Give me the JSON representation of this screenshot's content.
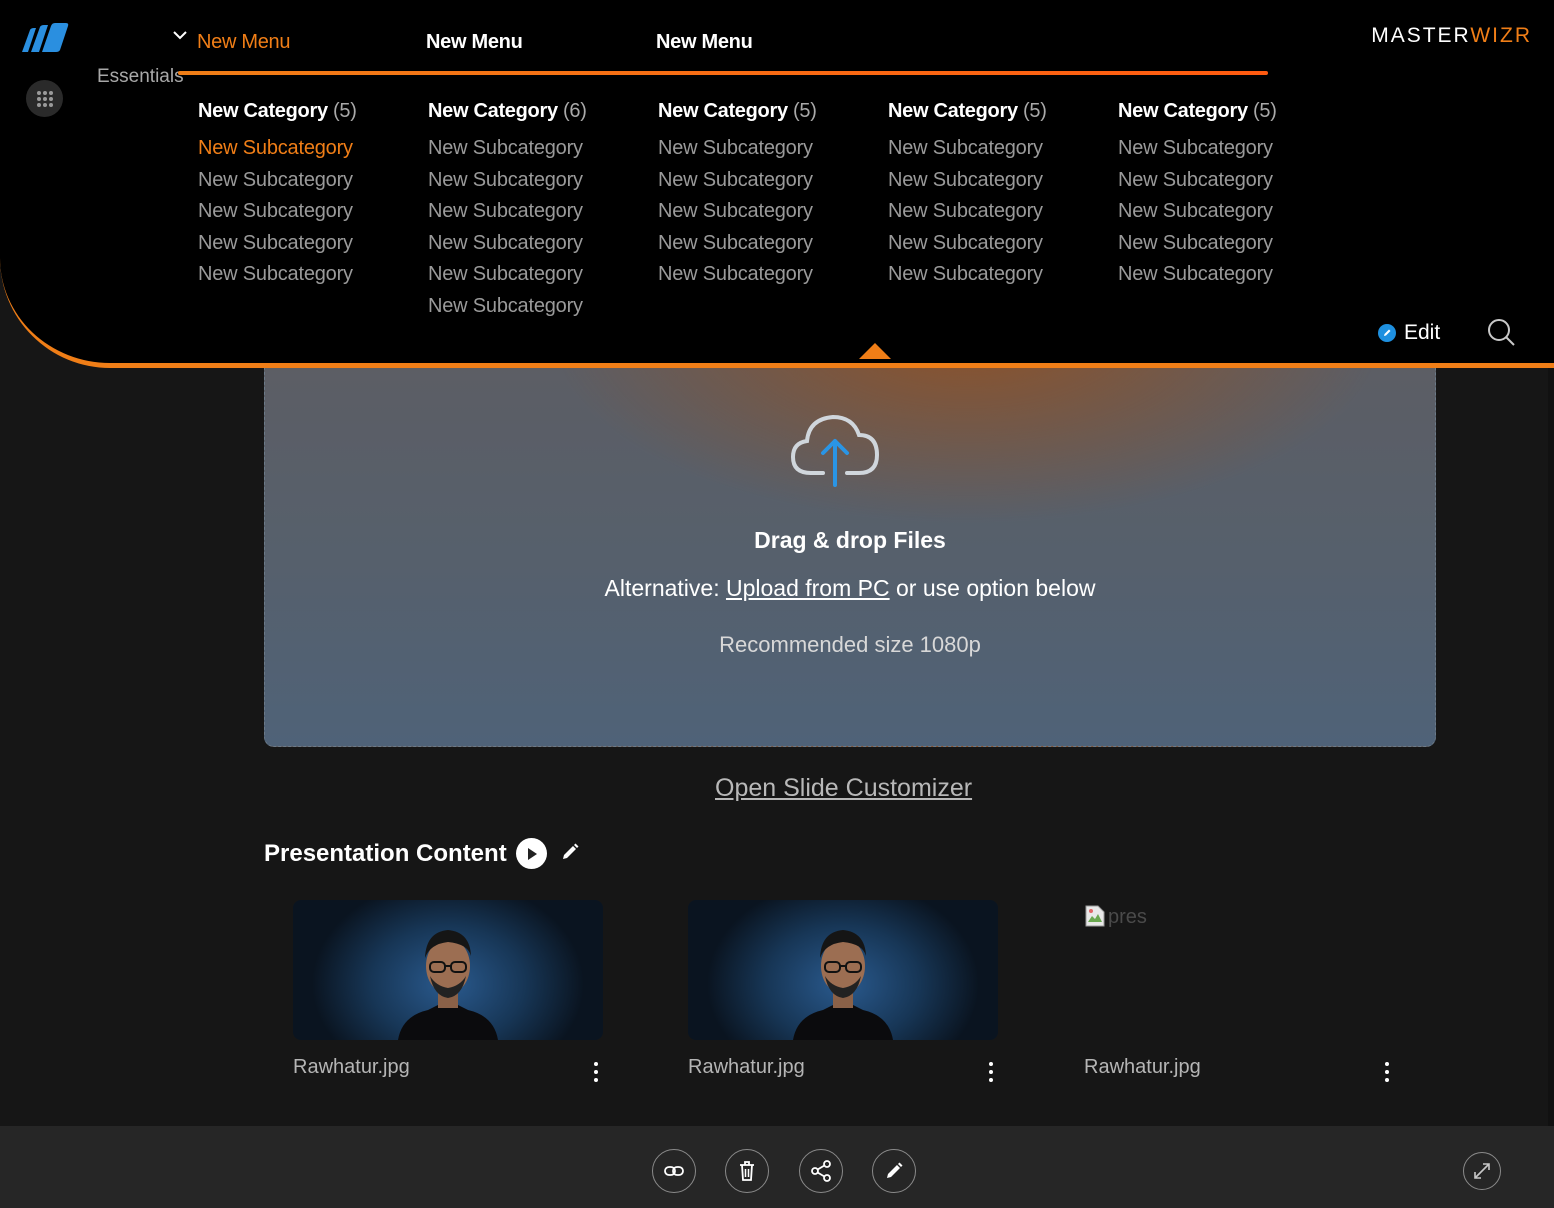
{
  "brand": {
    "master": "MASTER",
    "wizr": "WIZR"
  },
  "sidebar": {
    "essentials_label": "Essentials"
  },
  "menus": [
    {
      "label": "New Menu",
      "active": true
    },
    {
      "label": "New Menu",
      "active": false
    },
    {
      "label": "New Menu",
      "active": false
    }
  ],
  "categories": [
    {
      "title": "New Category",
      "count": "(5)",
      "subs": [
        "New Subcategory",
        "New Subcategory",
        "New Subcategory",
        "New Subcategory",
        "New Subcategory"
      ]
    },
    {
      "title": "New Category",
      "count": "(6)",
      "subs": [
        "New Subcategory",
        "New Subcategory",
        "New Subcategory",
        "New Subcategory",
        "New Subcategory",
        "New Subcategory"
      ]
    },
    {
      "title": "New Category",
      "count": "(5)",
      "subs": [
        "New Subcategory",
        "New Subcategory",
        "New Subcategory",
        "New Subcategory",
        "New Subcategory"
      ]
    },
    {
      "title": "New Category",
      "count": "(5)",
      "subs": [
        "New Subcategory",
        "New Subcategory",
        "New Subcategory",
        "New Subcategory",
        "New Subcategory"
      ]
    },
    {
      "title": "New Category",
      "count": "(5)",
      "subs": [
        "New Subcategory",
        "New Subcategory",
        "New Subcategory",
        "New Subcategory",
        "New Subcategory"
      ]
    }
  ],
  "edit_label": "Edit",
  "upload": {
    "title": "Drag & drop Files",
    "alt_prefix": "Alternative: ",
    "alt_link": "Upload from PC",
    "alt_suffix": " or use option below",
    "recommended": "Recommended size 1080p"
  },
  "customizer_link": "Open Slide Customizer",
  "presentation": {
    "title": "Presentation Content",
    "items": [
      {
        "filename": "Rawhatur.jpg",
        "broken": false
      },
      {
        "filename": "Rawhatur.jpg",
        "broken": false
      },
      {
        "filename": "Rawhatur.jpg",
        "broken": true,
        "alt": "pres"
      }
    ]
  },
  "colors": {
    "accent": "#f07e17",
    "edit_blue": "#1e90e0",
    "logo_blue": "#2a8fe0"
  },
  "icons": [
    "logo-icon",
    "apps-grid-icon",
    "chevron-down-icon",
    "search-icon",
    "edit-icon",
    "upload-cloud-icon",
    "play-icon",
    "pencil-icon",
    "kebab-icon",
    "link-icon",
    "trash-icon",
    "share-icon",
    "pen-icon",
    "expand-icon"
  ]
}
